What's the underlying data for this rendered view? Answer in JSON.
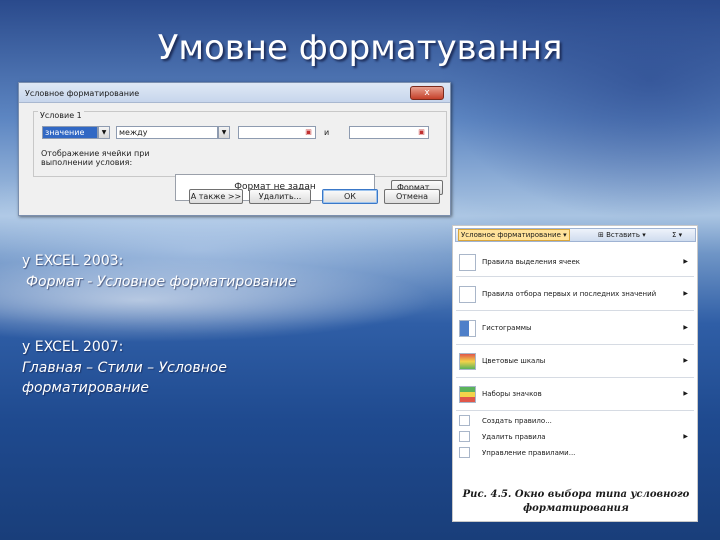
{
  "slide": {
    "title": "Умовне форматування"
  },
  "dialog": {
    "title": "Условное форматирование",
    "close_label": "x",
    "condition_group_label": "Условие 1",
    "condition_type": "значение",
    "operator": "между",
    "value_1": "",
    "and_label": "и",
    "value_2": "",
    "preview_label": "Отображение ячейки при выполнении условия:",
    "preview_text": "Формат не задан",
    "format_button": "Формат...",
    "also_button": "А также >>",
    "delete_button": "Удалить...",
    "ok_button": "ОК",
    "cancel_button": "Отмена"
  },
  "text": {
    "excel2003_heading": "у EXCEL 2003:",
    "excel2003_path": "Формат - Условное форматирование",
    "excel2007_heading": "у EXCEL 2007:",
    "excel2007_path_line1": "Главная – Стили – Условное",
    "excel2007_path_line2": "форматирование"
  },
  "menu_figure": {
    "ribbon_button": "Условное форматирование",
    "insert_button": "Вставить",
    "menu_items": [
      {
        "label": "Правила выделения ячеек",
        "icon": "highlight-rules-icon"
      },
      {
        "label": "Правила отбора первых и последних значений",
        "icon": "top-bottom-rules-icon"
      },
      {
        "label": "Гистограммы",
        "icon": "data-bars-icon"
      },
      {
        "label": "Цветовые шкалы",
        "icon": "color-scales-icon"
      },
      {
        "label": "Наборы значков",
        "icon": "icon-sets-icon"
      }
    ],
    "small_items": [
      {
        "label": "Создать правило...",
        "icon": "new-rule-icon"
      },
      {
        "label": "Удалить правила",
        "icon": "clear-rules-icon"
      },
      {
        "label": "Управление правилами...",
        "icon": "manage-rules-icon"
      }
    ],
    "caption_line1": "Рис. 4.5. Окно выбора типа условного",
    "caption_line2": "форматирования"
  }
}
